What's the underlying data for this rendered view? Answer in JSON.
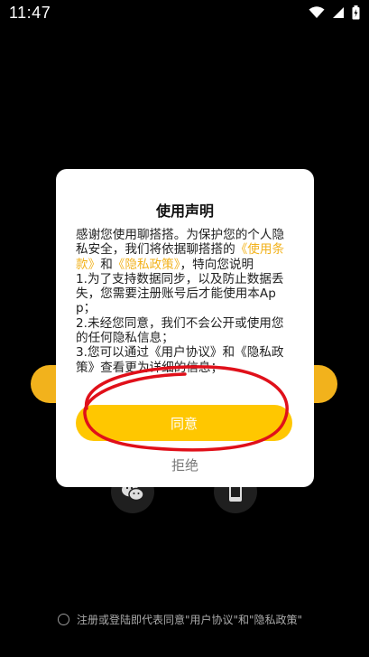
{
  "status_bar": {
    "time": "11:47"
  },
  "dialog": {
    "title": "使用声明",
    "intro_prefix": "感谢您使用聊搭搭。为保护您的个人隐私安全，我们将依据聊搭搭的",
    "terms_link": "《使用条款》",
    "and": "和",
    "privacy_link": "《隐私政策》",
    "intro_suffix": "，特向您说明",
    "point1": "1.为了支持数据同步，以及防止数据丢失，您需要注册账号后才能使用本App；",
    "point2": "2.未经您同意，我们不会公开或使用您的任何隐私信息；",
    "point3": "3.您可以通过《用户协议》和《隐私政策》查看更为详细的信息；",
    "agree_label": "同意",
    "reject_label": "拒绝",
    "accent_color": "#ffc700"
  },
  "footer": {
    "consent_text": "注册或登陆即代表同意\"用户协议\"和\"隐私政策\""
  },
  "icons": [
    "wifi-icon",
    "signal-icon",
    "battery-icon",
    "wechat-icon",
    "phone-icon"
  ]
}
